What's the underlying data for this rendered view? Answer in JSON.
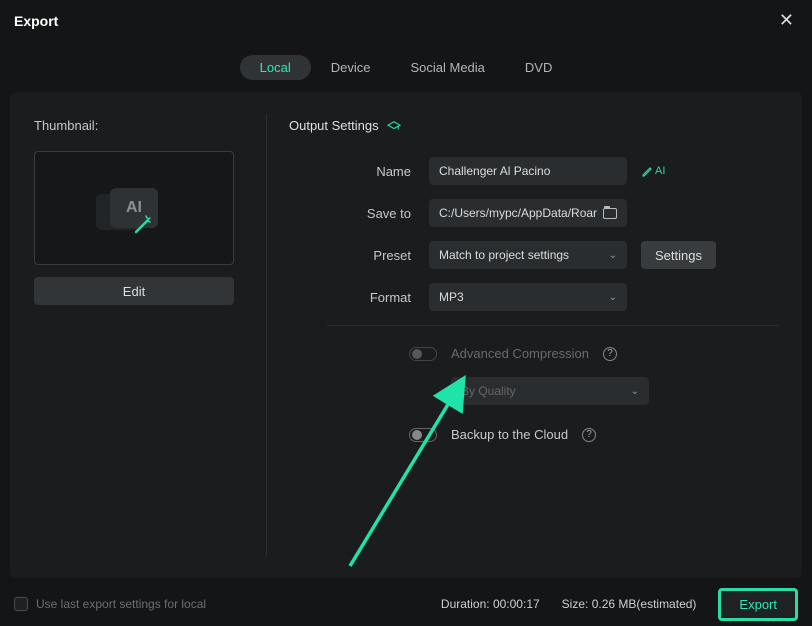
{
  "title": "Export",
  "tabs": [
    "Local",
    "Device",
    "Social Media",
    "DVD"
  ],
  "activeTab": 0,
  "thumbnail": {
    "label": "Thumbnail:",
    "editLabel": "Edit"
  },
  "output": {
    "heading": "Output Settings",
    "rows": {
      "name": {
        "label": "Name",
        "value": "Challenger Al Pacino",
        "aiLabel": "AI"
      },
      "saveTo": {
        "label": "Save to",
        "value": "C:/Users/mypc/AppData/Roar"
      },
      "preset": {
        "label": "Preset",
        "value": "Match to project settings",
        "settings": "Settings"
      },
      "format": {
        "label": "Format",
        "value": "MP3"
      }
    },
    "advanced": {
      "label": "Advanced Compression",
      "subValue": "By Quality"
    },
    "backup": {
      "label": "Backup to the Cloud"
    }
  },
  "footer": {
    "useLast": "Use last export settings for local",
    "durationLabel": "Duration:",
    "durationValue": "00:00:17",
    "sizeLabel": "Size:",
    "sizeValue": "0.26 MB(estimated)",
    "exportLabel": "Export"
  }
}
